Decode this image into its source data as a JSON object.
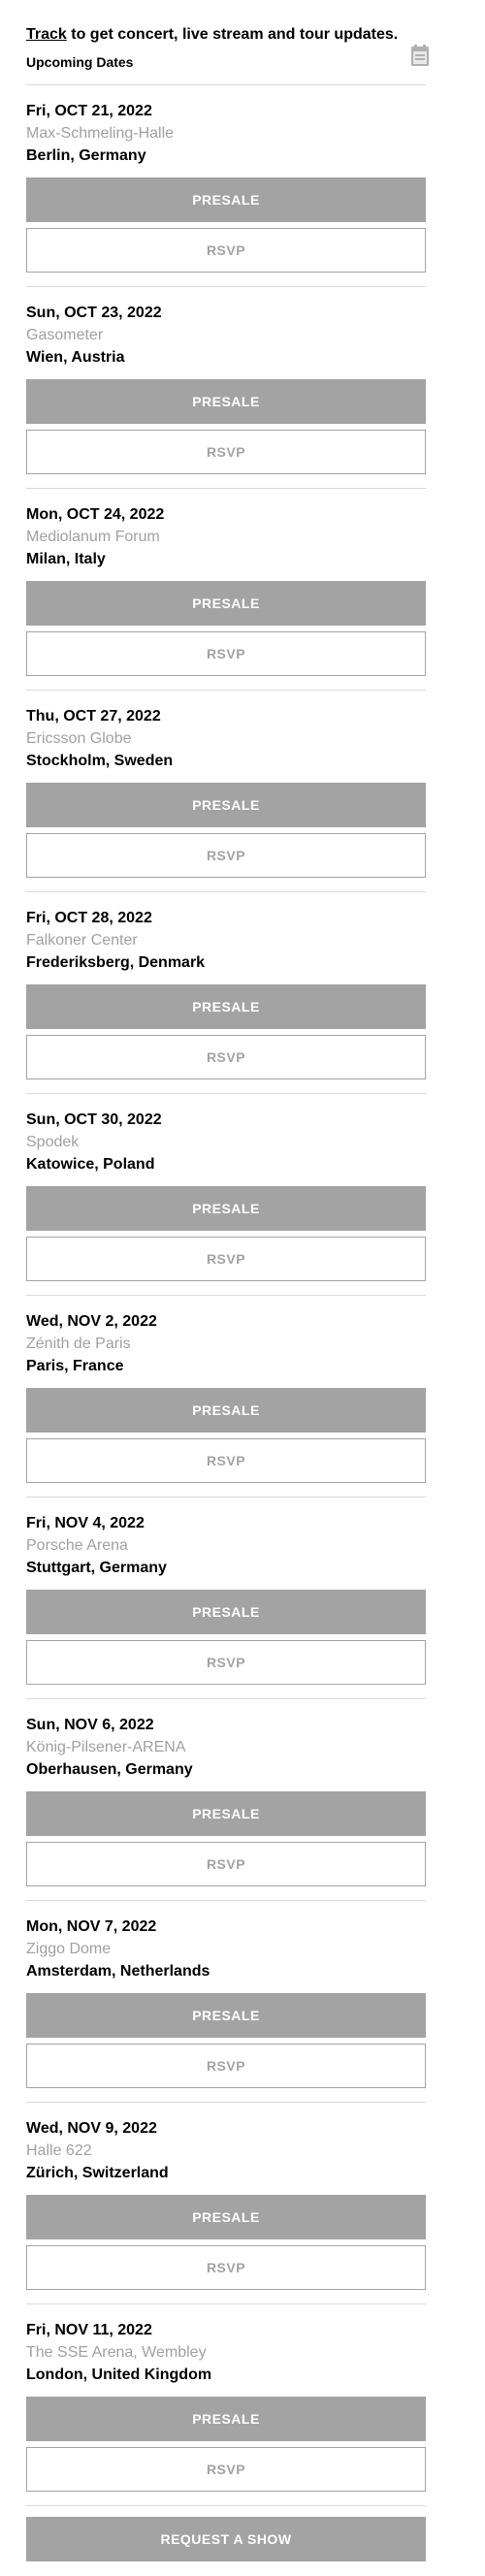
{
  "header": {
    "track_link": "Track",
    "track_text": " to get concert, live stream and tour updates.",
    "upcoming_label": "Upcoming Dates",
    "calendar_icon": "calendar-icon"
  },
  "colors": {
    "button_gray": "#a3a3a3",
    "venue_gray": "#a0a0a0",
    "divider": "#d9d9d9"
  },
  "events": [
    {
      "date": "Fri, OCT 21, 2022",
      "venue": "Max-Schmeling-Halle",
      "location": "Berlin, Germany",
      "presale": "PRESALE",
      "rsvp": "RSVP"
    },
    {
      "date": "Sun, OCT 23, 2022",
      "venue": "Gasometer",
      "location": "Wien, Austria",
      "presale": "PRESALE",
      "rsvp": "RSVP"
    },
    {
      "date": "Mon, OCT 24, 2022",
      "venue": "Mediolanum Forum",
      "location": "Milan, Italy",
      "presale": "PRESALE",
      "rsvp": "RSVP"
    },
    {
      "date": "Thu, OCT 27, 2022",
      "venue": "Ericsson Globe",
      "location": "Stockholm, Sweden",
      "presale": "PRESALE",
      "rsvp": "RSVP"
    },
    {
      "date": "Fri, OCT 28, 2022",
      "venue": "Falkoner Center",
      "location": "Frederiksberg, Denmark",
      "presale": "PRESALE",
      "rsvp": "RSVP"
    },
    {
      "date": "Sun, OCT 30, 2022",
      "venue": "Spodek",
      "location": "Katowice, Poland",
      "presale": "PRESALE",
      "rsvp": "RSVP"
    },
    {
      "date": "Wed, NOV 2, 2022",
      "venue": "Zénith de Paris",
      "location": "Paris, France",
      "presale": "PRESALE",
      "rsvp": "RSVP"
    },
    {
      "date": "Fri, NOV 4, 2022",
      "venue": "Porsche Arena",
      "location": "Stuttgart, Germany",
      "presale": "PRESALE",
      "rsvp": "RSVP"
    },
    {
      "date": "Sun, NOV 6, 2022",
      "venue": "König-Pilsener-ARENA",
      "location": "Oberhausen, Germany",
      "presale": "PRESALE",
      "rsvp": "RSVP"
    },
    {
      "date": "Mon, NOV 7, 2022",
      "venue": "Ziggo Dome",
      "location": "Amsterdam, Netherlands",
      "presale": "PRESALE",
      "rsvp": "RSVP"
    },
    {
      "date": "Wed, NOV 9, 2022",
      "venue": "Halle 622",
      "location": "Zürich, Switzerland",
      "presale": "PRESALE",
      "rsvp": "RSVP"
    },
    {
      "date": "Fri, NOV 11, 2022",
      "venue": "The SSE Arena, Wembley",
      "location": "London, United Kingdom",
      "presale": "PRESALE",
      "rsvp": "RSVP"
    }
  ],
  "footer": {
    "request_label": "REQUEST A SHOW"
  }
}
